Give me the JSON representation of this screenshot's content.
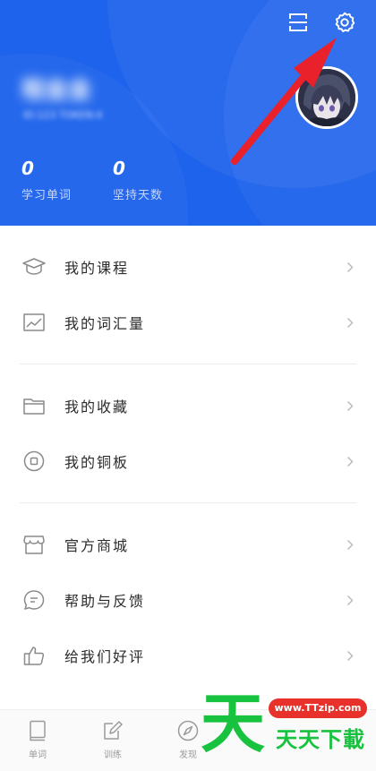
{
  "header": {
    "user_name": "程金金",
    "user_meta": "ID:123  TOKEN:4",
    "stats": [
      {
        "value": "0",
        "label": "学习单词"
      },
      {
        "value": "0",
        "label": "坚持天数"
      }
    ]
  },
  "menu": {
    "groups": [
      {
        "items": [
          {
            "label": "我的课程",
            "icon": "graduation-cap-icon"
          },
          {
            "label": "我的词汇量",
            "icon": "chart-icon"
          }
        ]
      },
      {
        "items": [
          {
            "label": "我的收藏",
            "icon": "folder-icon"
          },
          {
            "label": "我的铜板",
            "icon": "coin-icon"
          }
        ]
      },
      {
        "items": [
          {
            "label": "官方商城",
            "icon": "store-icon"
          },
          {
            "label": "帮助与反馈",
            "icon": "chat-icon"
          },
          {
            "label": "给我们好评",
            "icon": "thumbs-up-icon"
          }
        ]
      }
    ]
  },
  "bottom_nav": {
    "items": [
      {
        "label": "单词",
        "icon": "book-icon"
      },
      {
        "label": "训练",
        "icon": "edit-icon"
      },
      {
        "label": "发现",
        "icon": "compass-icon"
      }
    ]
  },
  "watermark": {
    "big_char": "天",
    "url": "www.TTzip.com",
    "text": "天天下載"
  },
  "colors": {
    "header_bg": "#1e63ec",
    "arrow": "#e8212b",
    "watermark_green": "#16c23e",
    "watermark_red": "#e8312b"
  }
}
